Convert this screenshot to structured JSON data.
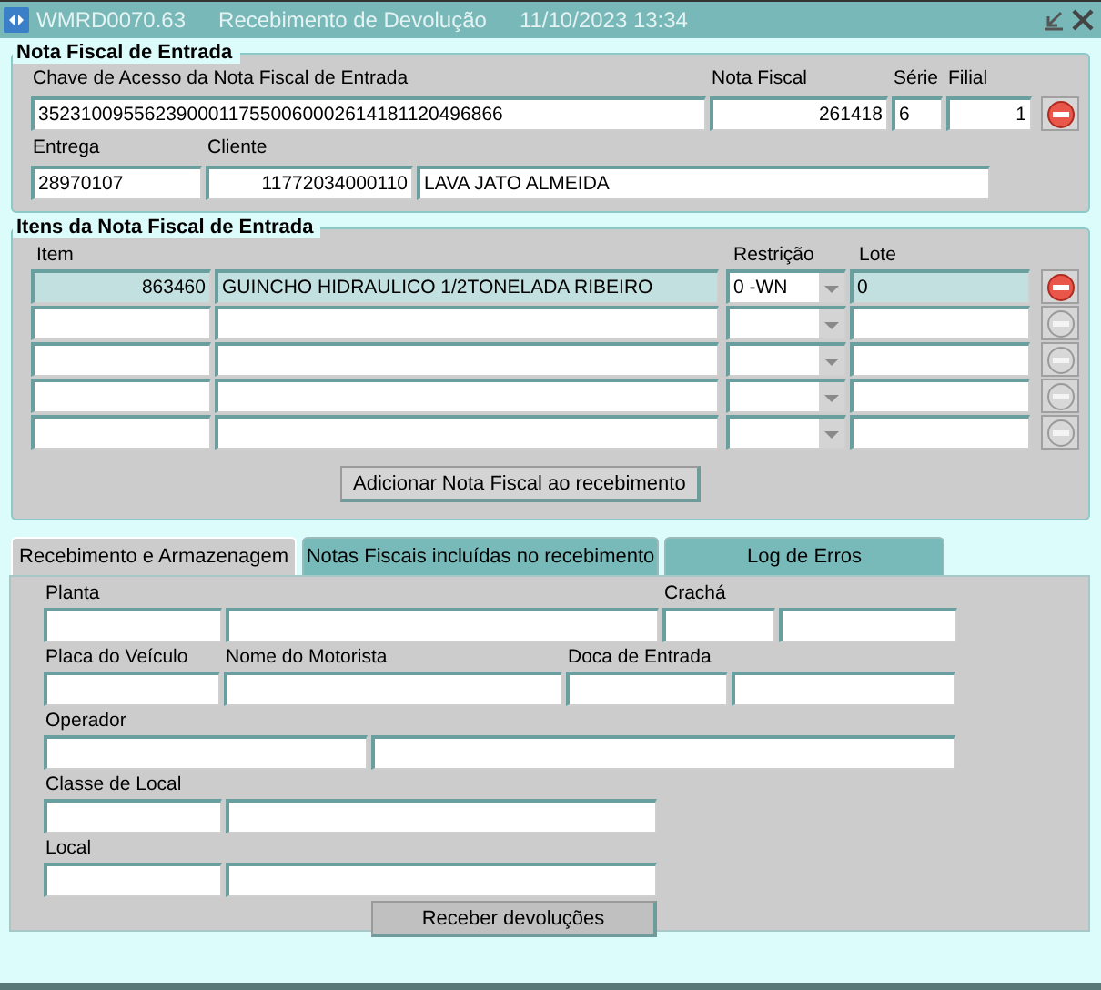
{
  "window": {
    "title": "WMRD0070.63",
    "subtitle": "Recebimento de Devolução",
    "timestamp": "11/10/2023 13:34"
  },
  "invoice_group": {
    "legend": "Nota Fiscal de Entrada",
    "remove_enabled": true,
    "access_key": {
      "label": "Chave de Acesso da Nota Fiscal de Entrada",
      "value": "35231009556239000117550060002614181120496866"
    },
    "invoice_number": {
      "label": "Nota Fiscal",
      "value": "261418",
      "kind": "number"
    },
    "series": {
      "label": "Série",
      "value": "6"
    },
    "branch": {
      "label": "Filial",
      "value": "1",
      "kind": "number"
    },
    "delivery": {
      "label": "Entrega",
      "value": "28970107"
    },
    "customer_code": {
      "label": "Cliente",
      "value": "11772034000110",
      "kind": "number"
    },
    "customer_name": {
      "value": "LAVA  JATO ALMEIDA"
    }
  },
  "items_group": {
    "legend": "Itens da Nota Fiscal de Entrada",
    "columns": [
      "Item",
      "Restrição",
      "Lote"
    ],
    "rows": [
      {
        "item": "863460",
        "description": "GUINCHO HIDRAULICO 1/2TONELADA RIBEIRO",
        "restriction": "0 -WN",
        "lot": "0",
        "selected": true,
        "remove_enabled": true
      },
      {
        "selected": false,
        "remove_enabled": false
      },
      {
        "selected": false,
        "remove_enabled": false
      },
      {
        "selected": false,
        "remove_enabled": false
      },
      {
        "selected": false,
        "remove_enabled": false
      }
    ],
    "add_button": "Adicionar Nota Fiscal ao recebimento"
  },
  "tabs": [
    {
      "label": "Recebimento e Armazenagem",
      "selected": true
    },
    {
      "label": "Notas Fiscais incluídas no recebimento",
      "selected": false
    },
    {
      "label": "Log de Erros",
      "selected": false
    }
  ],
  "tab_form": {
    "rows": [
      [
        {
          "label": "Planta"
        },
        {},
        {
          "label": "Crachá"
        },
        {}
      ],
      [
        {
          "label": "Placa do Veículo"
        },
        {
          "label": "Nome do Motorista"
        },
        {
          "label": "Doca de Entrada"
        },
        {}
      ],
      [
        {
          "label": "Operador"
        },
        {}
      ],
      [
        {
          "label": "Classe de Local"
        },
        {}
      ],
      [
        {
          "label": "Local"
        },
        {}
      ]
    ],
    "submit_button": "Receber devoluções"
  }
}
